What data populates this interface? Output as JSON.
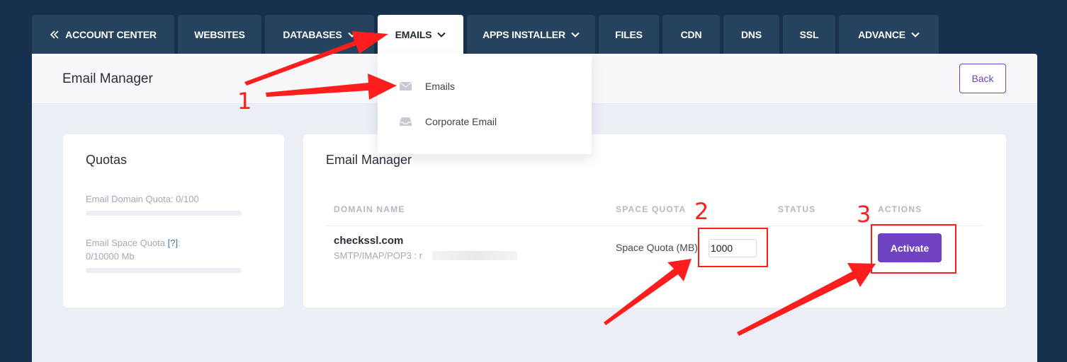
{
  "nav": {
    "tabs": [
      {
        "label": "ACCOUNT CENTER",
        "icon": "double-chevron-left-icon",
        "active": false
      },
      {
        "label": "WEBSITES",
        "active": false
      },
      {
        "label": "DATABASES",
        "icon": "chevron-down-icon",
        "active": false
      },
      {
        "label": "EMAILS",
        "icon": "chevron-down-icon",
        "active": true
      },
      {
        "label": "APPS INSTALLER",
        "icon": "chevron-down-icon",
        "active": false
      },
      {
        "label": "FILES",
        "active": false
      },
      {
        "label": "CDN",
        "active": false
      },
      {
        "label": "DNS",
        "active": false
      },
      {
        "label": "SSL",
        "active": false
      },
      {
        "label": "ADVANCE",
        "icon": "chevron-down-icon",
        "active": false
      }
    ]
  },
  "dropdown": {
    "items": [
      {
        "label": "Emails",
        "icon": "envelope-icon"
      },
      {
        "label": "Corporate Email",
        "icon": "inbox-tray-icon"
      }
    ]
  },
  "header": {
    "title": "Email Manager",
    "back_label": "Back"
  },
  "quotas": {
    "title": "Quotas",
    "domain_quota_label": "Email Domain Quota: 0/100",
    "space_quota_label": "Email Space Quota",
    "space_quota_help": "[?]",
    "space_quota_colon": ":",
    "space_quota_value": "0/10000 Mb",
    "domain_quota_fraction": 0,
    "space_quota_fraction": 0
  },
  "manager": {
    "title": "Email Manager",
    "columns": [
      "DOMAIN NAME",
      "SPACE QUOTA",
      "STATUS",
      "ACTIONS"
    ],
    "row": {
      "domain": "checkssl.com",
      "protocols": "SMTP/IMAP/POP3 : r",
      "space_quota_label": "Space Quota (MB)",
      "space_quota_value": "1000",
      "status": "",
      "action_label": "Activate"
    }
  },
  "annotations": {
    "step1": "1",
    "step2": "2",
    "step3": "3"
  },
  "colors": {
    "nav_bg": "#16304d",
    "tab_bg": "#25425e",
    "accent": "#6f42c1",
    "annotation": "#ff1e1e"
  }
}
